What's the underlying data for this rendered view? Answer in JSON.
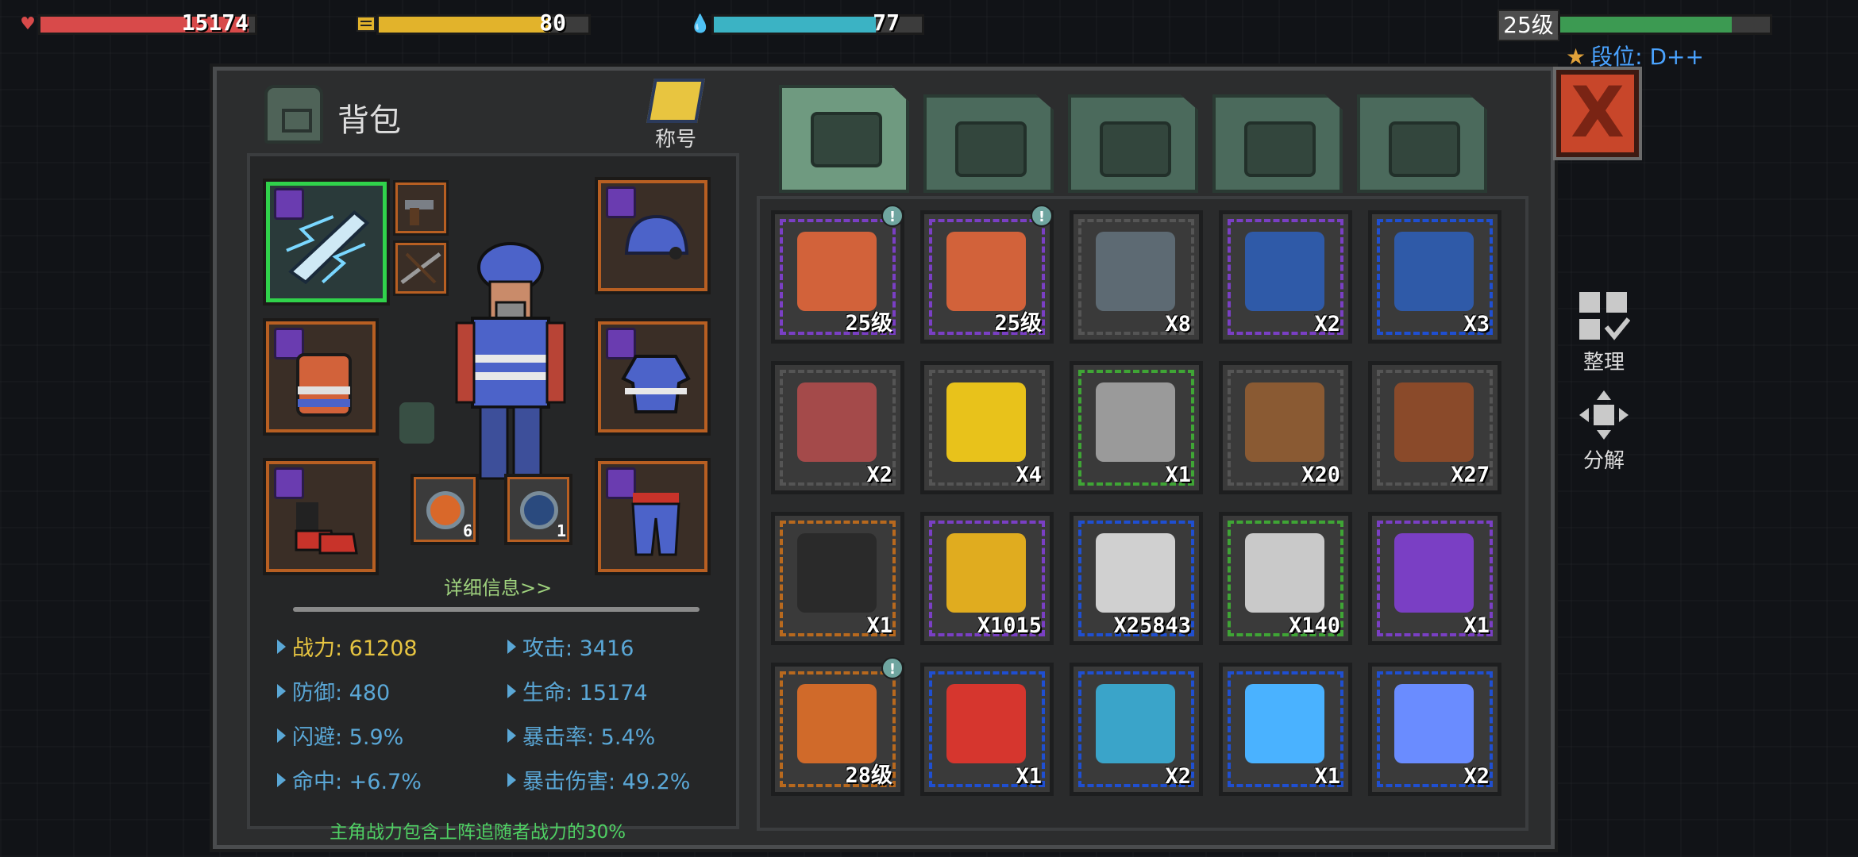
{
  "hud": {
    "hp": {
      "value": "15174",
      "fill": 0.97,
      "color": "#d84a4a",
      "icon": "heart-icon"
    },
    "energy": {
      "value": "80",
      "fill": 0.82,
      "color": "#e2b32b",
      "icon": "battery-icon"
    },
    "water": {
      "value": "77",
      "fill": 0.78,
      "color": "#3bb3c4",
      "icon": "water-drop-icon"
    },
    "level": {
      "label": "25级",
      "fill": 0.82,
      "color": "#3c9a52"
    },
    "rank": {
      "label": "段位: D++",
      "icon": "star-icon"
    }
  },
  "panel": {
    "title": "背包",
    "nickname_label": "称号",
    "detail_link": "详细信息>>",
    "note": "主角战力包含上阵追随者战力的30%",
    "close_label": "X"
  },
  "equipment": {
    "ring_counts": [
      "6",
      "1"
    ]
  },
  "stats": [
    {
      "label": "战力: 61208",
      "kind": "power"
    },
    {
      "label": "攻击: 3416",
      "kind": "normal"
    },
    {
      "label": "防御: 480",
      "kind": "normal"
    },
    {
      "label": "生命: 15174",
      "kind": "normal"
    },
    {
      "label": "闪避: 5.9%",
      "kind": "normal"
    },
    {
      "label": "暴击率: 5.4%",
      "kind": "normal"
    },
    {
      "label": "命中: +6.7%",
      "kind": "normal"
    },
    {
      "label": "暴击伤害: 49.2%",
      "kind": "normal"
    }
  ],
  "tabs": [
    {
      "name": "tab-backpack",
      "icon": "backpack-icon",
      "active": true
    },
    {
      "name": "tab-medical",
      "icon": "medkit-icon",
      "active": false
    },
    {
      "name": "tab-armor",
      "icon": "armor-icon",
      "active": false
    },
    {
      "name": "tab-weapons",
      "icon": "pistol-icon",
      "active": false
    },
    {
      "name": "tab-tools",
      "icon": "wrench-icon",
      "active": false
    }
  ],
  "items": [
    {
      "name": "vest-item",
      "qty": "25级",
      "rarity": "purple",
      "color": "#d2623a",
      "alert": true
    },
    {
      "name": "vest-item",
      "qty": "25级",
      "rarity": "purple",
      "color": "#d2623a",
      "alert": true
    },
    {
      "name": "iron-ore-item",
      "qty": "X8",
      "rarity": "gray",
      "color": "#5d6a73",
      "alert": false
    },
    {
      "name": "data-chip-item",
      "qty": "X2",
      "rarity": "purple",
      "color": "#2f5aa8",
      "alert": false
    },
    {
      "name": "data-chip-item",
      "qty": "X3",
      "rarity": "blue",
      "color": "#2f5aa8",
      "alert": false
    },
    {
      "name": "raw-meat-item",
      "qty": "X2",
      "rarity": "gray",
      "color": "#a44a4a",
      "alert": false
    },
    {
      "name": "oil-can-item",
      "qty": "X4",
      "rarity": "gray",
      "color": "#e8c21b",
      "alert": false
    },
    {
      "name": "tool-weapon-item",
      "qty": "X1",
      "rarity": "green",
      "color": "#9a9a9a",
      "alert": false
    },
    {
      "name": "mushroom-item",
      "qty": "X20",
      "rarity": "gray",
      "color": "#8a5a33",
      "alert": false
    },
    {
      "name": "steak-item",
      "qty": "X27",
      "rarity": "gray",
      "color": "#8a4a2a",
      "alert": false
    },
    {
      "name": "sale-coupon-item",
      "qty": "X1",
      "rarity": "orange",
      "color": "#2a2a2a",
      "alert": false
    },
    {
      "name": "gold-coin-item",
      "qty": "X1015",
      "rarity": "purple",
      "color": "#e0ac1f",
      "alert": false
    },
    {
      "name": "silver-coin-item",
      "qty": "X25843",
      "rarity": "blue",
      "color": "#d0d0d0",
      "alert": false
    },
    {
      "name": "eagle-badge-item",
      "qty": "X140",
      "rarity": "green",
      "color": "#c9c9c9",
      "alert": false
    },
    {
      "name": "plus-card-item",
      "qty": "X1",
      "rarity": "purple",
      "color": "#7a3fc4",
      "alert": false
    },
    {
      "name": "helmet-item",
      "qty": "28级",
      "rarity": "orange",
      "color": "#d06a2a",
      "alert": true
    },
    {
      "name": "red-device-item",
      "qty": "X1",
      "rarity": "blue",
      "color": "#d6362e",
      "alert": false
    },
    {
      "name": "blue-device-item",
      "qty": "X2",
      "rarity": "blue",
      "color": "#3aa4c9",
      "alert": false
    },
    {
      "name": "lightning-crystal-item",
      "qty": "X1",
      "rarity": "blue",
      "color": "#4ab2ff",
      "alert": false
    },
    {
      "name": "blue-crystal-item",
      "qty": "X2",
      "rarity": "blue",
      "color": "#6a8cff",
      "alert": false
    }
  ],
  "side": {
    "sort_label": "整理",
    "disassemble_label": "分解"
  }
}
